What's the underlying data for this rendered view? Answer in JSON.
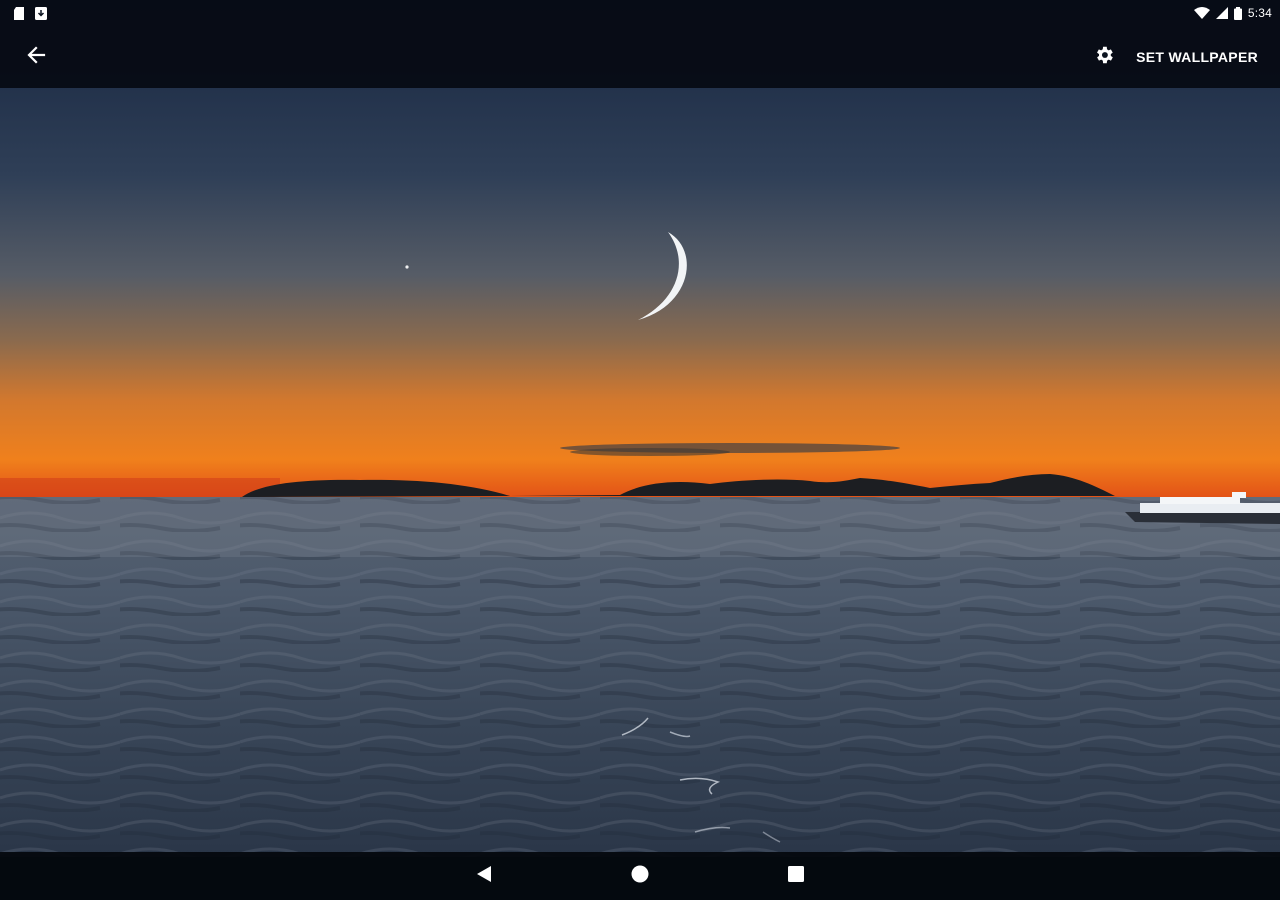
{
  "status_bar": {
    "time": "5:34",
    "notification_icons": [
      "sd-card-icon",
      "download-icon"
    ],
    "system_icons": [
      "wifi-icon",
      "signal-icon",
      "battery-icon"
    ]
  },
  "app_bar": {
    "back_icon": "arrow-back-icon",
    "settings_icon": "gear-icon",
    "set_wallpaper_label": "SET WALLPAPER"
  },
  "wallpaper": {
    "subject": "moon-over-sea-sunset-preview",
    "colors": {
      "sky_top": "#1b2a42",
      "sky_mid": "#4a5668",
      "horizon_orange": "#f07a1a",
      "horizon_red": "#d84318",
      "water": "#3a4658"
    }
  },
  "nav_bar": {
    "icons": [
      "nav-back-icon",
      "nav-home-icon",
      "nav-recents-icon"
    ]
  }
}
